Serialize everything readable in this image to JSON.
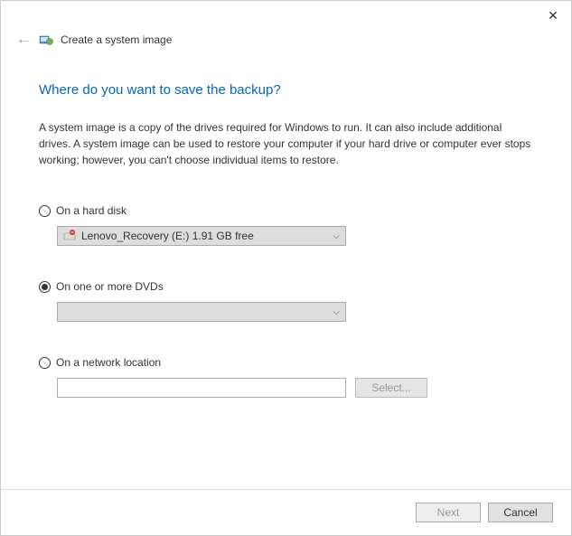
{
  "titlebar": {
    "close": "✕"
  },
  "header": {
    "back": "←",
    "title": "Create a system image"
  },
  "main": {
    "heading": "Where do you want to save the backup?",
    "description": "A system image is a copy of the drives required for Windows to run. It can also include additional drives. A system image can be used to restore your computer if your hard drive or computer ever stops working; however, you can't choose individual items to restore."
  },
  "options": {
    "hard_disk": {
      "label": "On a hard disk",
      "selected_drive": "Lenovo_Recovery (E:)  1.91 GB free"
    },
    "dvd": {
      "label": "On one or more DVDs",
      "selected_drive": ""
    },
    "network": {
      "label": "On a network location",
      "value": "",
      "select_button": "Select..."
    }
  },
  "footer": {
    "next": "Next",
    "cancel": "Cancel"
  }
}
